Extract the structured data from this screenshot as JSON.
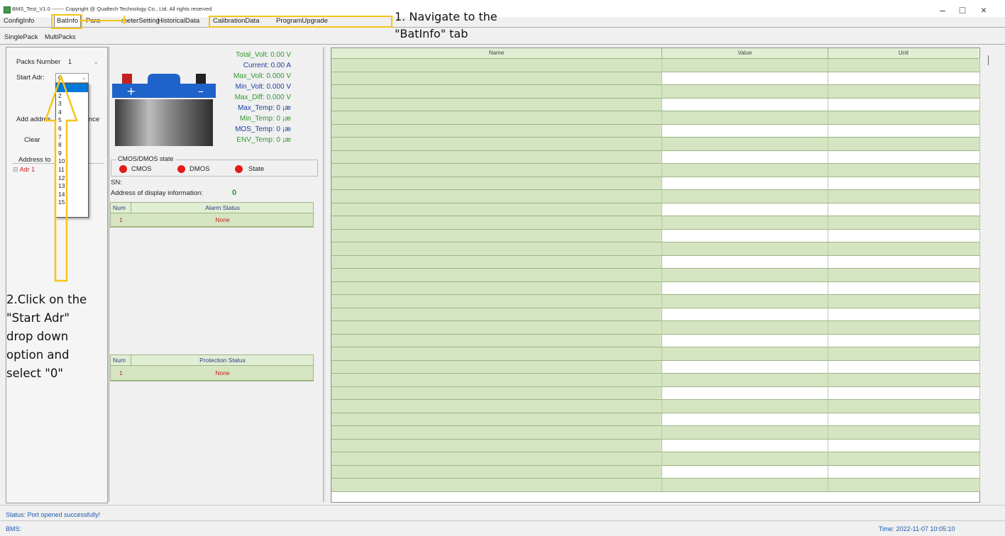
{
  "window": {
    "title": "BMS_Test_V1.0  -------  Copyright @ Qualtech Technology Co., Ltd. All rights reserved",
    "controls": [
      "–",
      "□",
      "×"
    ]
  },
  "tabs": [
    {
      "label": "ConfigInfo"
    },
    {
      "label": "BatInfo"
    },
    {
      "label": "Para"
    },
    {
      "label": "meterSetting"
    },
    {
      "label": "HistoricalData"
    },
    {
      "label": "CalibrationData"
    },
    {
      "label": "ProgramUpgrade"
    }
  ],
  "subtabs": [
    {
      "label": "SinglePack"
    },
    {
      "label": "MultiPacks"
    }
  ],
  "left": {
    "packs_label": "Packs Number",
    "packs_value": "1",
    "start_label": "Start Adr:",
    "start_value": "0",
    "dropdown_options": [
      "",
      "2",
      "3",
      "4",
      "5",
      "6",
      "7",
      "8",
      "9",
      "10",
      "11",
      "12",
      "13",
      "14",
      "15"
    ],
    "add_addr_label": "Add addres",
    "add_addr_suffix": "nce",
    "clear_label": "Clear",
    "address_label": "Address to",
    "tree_item": "Adr 1"
  },
  "battery": {
    "total_volt": "Total_Volt: 0.00 V",
    "current": "Current: 0.00 A",
    "max_volt": "Max_Volt: 0.000 V",
    "min_volt": "Min_Volt: 0.000 V",
    "max_diff": "Max_Diff: 0.000 V",
    "max_temp": "Max_Temp: 0 ¡æ",
    "min_temp": "Min_Temp: 0 ¡æ",
    "mos_temp": "MOS_Temp: 0 ¡æ",
    "env_temp": "ENV_Temp: 0 ¡æ"
  },
  "mos_state": {
    "group_label": "CMOS/DMOS state",
    "cmos": "CMOS",
    "dmos": "DMOS",
    "state": "State"
  },
  "info": {
    "sn_label": "SN:",
    "address_label": "Address of display information:",
    "address_value": "0"
  },
  "alarm_table": {
    "headers": [
      "Num",
      "Alarm Status"
    ],
    "rows": [
      [
        "1",
        "None"
      ]
    ]
  },
  "protection_table": {
    "headers": [
      "Num",
      "Protection Status"
    ],
    "rows": [
      [
        "1",
        "None"
      ]
    ]
  },
  "grid": {
    "headers": [
      "Name",
      "Value",
      "Unit"
    ],
    "row_count": 33
  },
  "annotations": {
    "step1": [
      "1. Navigate to the",
      "\"BatInfo\" tab"
    ],
    "step2": [
      "2.Click on the",
      "\"Start Adr\"",
      "drop down",
      "option and",
      "select \"0\""
    ]
  },
  "status": {
    "message": "Status: Port opened successfully!",
    "bms": "BMS:",
    "time": "Time: 2022-11-07 10:05:10"
  },
  "colors": {
    "accent_green": "#2d9a2d",
    "accent_blue": "#1a3fa0",
    "row_green": "#d6e5c1",
    "highlight_yellow": "#f5c518",
    "alarm_red": "#e41a1a"
  }
}
